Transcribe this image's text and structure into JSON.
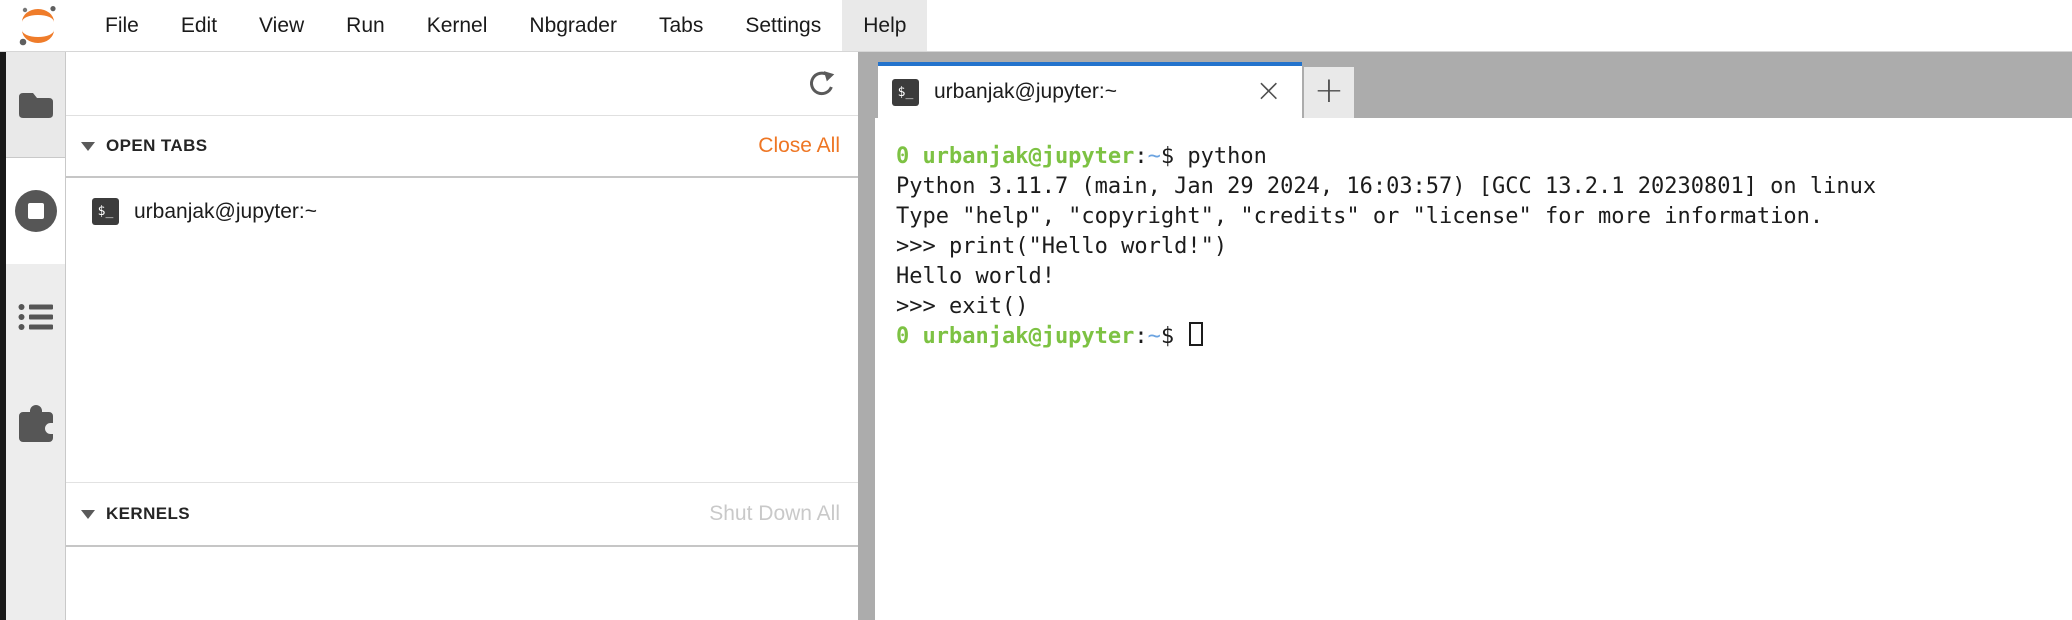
{
  "menu_bar": {
    "items": [
      {
        "label": "File"
      },
      {
        "label": "Edit"
      },
      {
        "label": "View"
      },
      {
        "label": "Run"
      },
      {
        "label": "Kernel"
      },
      {
        "label": "Nbgrader"
      },
      {
        "label": "Tabs"
      },
      {
        "label": "Settings"
      },
      {
        "label": "Help",
        "highlighted": true
      }
    ]
  },
  "sidebar": {
    "icons": [
      {
        "name": "file-browser-icon",
        "selected": false
      },
      {
        "name": "running-terminals-and-kernels-icon",
        "selected": true
      },
      {
        "name": "table-of-contents-icon",
        "selected": false
      },
      {
        "name": "extension-manager-icon",
        "selected": false
      }
    ]
  },
  "left_panel": {
    "open_tabs": {
      "title": "OPEN TABS",
      "action_label": "Close All",
      "items": [
        {
          "label": "urbanjak@jupyter:~"
        }
      ]
    },
    "kernels": {
      "title": "KERNELS",
      "action_label": "Shut Down All"
    }
  },
  "dock": {
    "tab": {
      "label": "urbanjak@jupyter:~"
    },
    "close_glyph": "×",
    "add_glyph": "+"
  },
  "glyphs": {
    "terminal_badge": "$_"
  },
  "terminal": {
    "lines": [
      {
        "segments": [
          {
            "text": "0 urbanjak@jupyter",
            "color": "green",
            "bold": true
          },
          {
            "text": ":",
            "color": "fg"
          },
          {
            "text": "~",
            "color": "blue"
          },
          {
            "text": "$ python",
            "color": "fg"
          }
        ]
      },
      {
        "segments": [
          {
            "text": "Python 3.11.7 (main, Jan 29 2024, 16:03:57) [GCC 13.2.1 20230801] on linux",
            "color": "fg"
          }
        ]
      },
      {
        "segments": [
          {
            "text": "Type \"help\", \"copyright\", \"credits\" or \"license\" for more information.",
            "color": "fg"
          }
        ]
      },
      {
        "segments": [
          {
            "text": ">>> print(\"Hello world!\")",
            "color": "fg"
          }
        ]
      },
      {
        "segments": [
          {
            "text": "Hello world!",
            "color": "fg"
          }
        ]
      },
      {
        "segments": [
          {
            "text": ">>> exit()",
            "color": "fg"
          }
        ]
      },
      {
        "segments": [
          {
            "text": "0 urbanjak@jupyter",
            "color": "green",
            "bold": true
          },
          {
            "text": ":",
            "color": "fg"
          },
          {
            "text": "~",
            "color": "blue"
          },
          {
            "text": "$ ",
            "color": "fg"
          }
        ],
        "cursor": true
      }
    ]
  },
  "colors": {
    "prompt_green": "#7dc243",
    "path_blue": "#6ba3e0",
    "terminal_fg": "#1c1c1c",
    "accent_orange": "#ee7624",
    "tab_accent_blue": "#2373cc"
  }
}
